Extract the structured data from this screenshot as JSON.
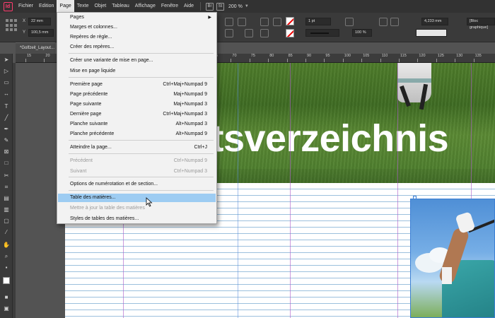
{
  "app": {
    "logo": "Id"
  },
  "menubar": {
    "items": [
      "Fichier",
      "Edition",
      "Page",
      "Texte",
      "Objet",
      "Tableau",
      "Affichage",
      "Fenêtre",
      "Aide"
    ],
    "active": "Page",
    "bridge": "Br",
    "stock": "St",
    "zoom": "200 %"
  },
  "controlbar": {
    "x_label": "X",
    "y_label": "Y",
    "x_value": "22 mm",
    "y_value": "100,5 mm",
    "stroke_weight": "1 pt",
    "opacity": "100 %",
    "size_value": "4,233 mm",
    "frame_label": "[Bloc graphique]"
  },
  "document": {
    "tab_title": "*Golfzeit_Layout..."
  },
  "ruler": {
    "ticks": [
      "15",
      "20",
      "25",
      "30",
      "35",
      "40",
      "45",
      "50",
      "55",
      "60",
      "65",
      "70",
      "75",
      "80",
      "85",
      "90",
      "95",
      "100",
      "105",
      "110",
      "115",
      "120",
      "125",
      "130",
      "135"
    ]
  },
  "canvas": {
    "hero_title": "ltsverzeichnis"
  },
  "page_menu": {
    "items": [
      {
        "label": "Pages",
        "shortcut": "",
        "submenu": true,
        "disabled": false,
        "highlighted": false
      },
      {
        "label": "Marges et colonnes...",
        "shortcut": "",
        "submenu": false,
        "disabled": false,
        "highlighted": false
      },
      {
        "label": "Repères de règle...",
        "shortcut": "",
        "submenu": false,
        "disabled": false,
        "highlighted": false
      },
      {
        "label": "Créer des repères...",
        "shortcut": "",
        "submenu": false,
        "disabled": false,
        "highlighted": false
      },
      {
        "label": "Créer une variante de mise en page...",
        "shortcut": "",
        "submenu": false,
        "disabled": false,
        "highlighted": false
      },
      {
        "label": "Mise en page liquide",
        "shortcut": "",
        "submenu": false,
        "disabled": false,
        "highlighted": false
      },
      {
        "label": "Première page",
        "shortcut": "Ctrl+Maj+Numpad 9",
        "submenu": false,
        "disabled": false,
        "highlighted": false
      },
      {
        "label": "Page précédente",
        "shortcut": "Maj+Numpad 9",
        "submenu": false,
        "disabled": false,
        "highlighted": false
      },
      {
        "label": "Page suivante",
        "shortcut": "Maj+Numpad 3",
        "submenu": false,
        "disabled": false,
        "highlighted": false
      },
      {
        "label": "Dernière page",
        "shortcut": "Ctrl+Maj+Numpad 3",
        "submenu": false,
        "disabled": false,
        "highlighted": false
      },
      {
        "label": "Planche suivante",
        "shortcut": "Alt+Numpad 3",
        "submenu": false,
        "disabled": false,
        "highlighted": false
      },
      {
        "label": "Planche précédente",
        "shortcut": "Alt+Numpad 9",
        "submenu": false,
        "disabled": false,
        "highlighted": false
      },
      {
        "label": "Atteindre la page...",
        "shortcut": "Ctrl+J",
        "submenu": false,
        "disabled": false,
        "highlighted": false
      },
      {
        "label": "Précédent",
        "shortcut": "Ctrl+Numpad 9",
        "submenu": false,
        "disabled": true,
        "highlighted": false
      },
      {
        "label": "Suivant",
        "shortcut": "Ctrl+Numpad 3",
        "submenu": false,
        "disabled": true,
        "highlighted": false
      },
      {
        "label": "Options de numérotation et de section...",
        "shortcut": "",
        "submenu": false,
        "disabled": false,
        "highlighted": false
      },
      {
        "label": "Table des matières...",
        "shortcut": "",
        "submenu": false,
        "disabled": false,
        "highlighted": true
      },
      {
        "label": "Mettre à jour la table des matières",
        "shortcut": "",
        "submenu": false,
        "disabled": true,
        "highlighted": false
      },
      {
        "label": "Styles de tables des matières...",
        "shortcut": "",
        "submenu": false,
        "disabled": false,
        "highlighted": false
      }
    ]
  },
  "colors": {
    "menu_highlight": "#9dccf2",
    "app_dark": "#323232",
    "guide_purple": "#aa5ac8",
    "baseline_blue": "#9cc0dd"
  }
}
